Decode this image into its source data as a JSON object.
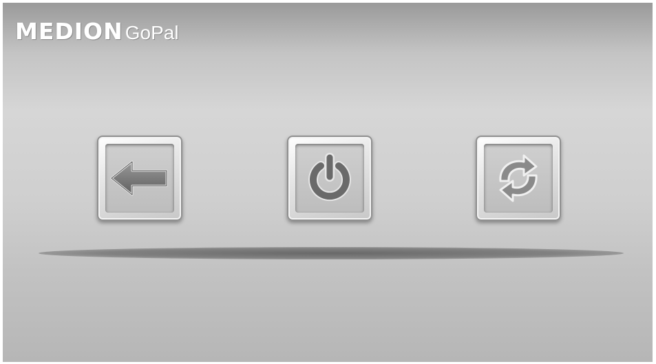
{
  "header": {
    "brand": "MEDION",
    "product": "GoPal"
  },
  "buttons": [
    {
      "id": "back",
      "icon": "arrow-left-icon"
    },
    {
      "id": "power",
      "icon": "power-icon"
    },
    {
      "id": "refresh",
      "icon": "refresh-icon"
    }
  ],
  "colors": {
    "background": "#cfcfcf",
    "icon": "#6e6e6e",
    "button_face": "#e6e6e6"
  }
}
